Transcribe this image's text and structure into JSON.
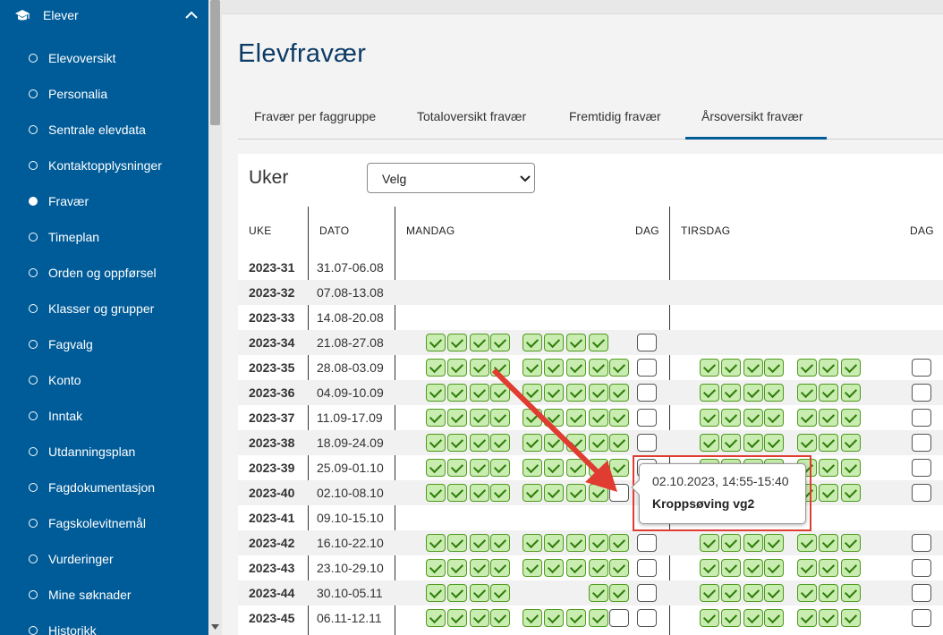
{
  "sidebar": {
    "header": "Elever",
    "items": [
      {
        "label": "Elevoversikt",
        "active": false
      },
      {
        "label": "Personalia",
        "active": false
      },
      {
        "label": "Sentrale elevdata",
        "active": false
      },
      {
        "label": "Kontaktopplysninger",
        "active": false
      },
      {
        "label": "Fravær",
        "active": true
      },
      {
        "label": "Timeplan",
        "active": false
      },
      {
        "label": "Orden og oppførsel",
        "active": false
      },
      {
        "label": "Klasser og grupper",
        "active": false
      },
      {
        "label": "Fagvalg",
        "active": false
      },
      {
        "label": "Konto",
        "active": false
      },
      {
        "label": "Inntak",
        "active": false
      },
      {
        "label": "Utdanningsplan",
        "active": false
      },
      {
        "label": "Fagdokumentasjon",
        "active": false
      },
      {
        "label": "Fagskolevitnemål",
        "active": false
      },
      {
        "label": "Vurderinger",
        "active": false
      },
      {
        "label": "Mine søknader",
        "active": false
      },
      {
        "label": "Historikk",
        "active": false
      }
    ]
  },
  "page_title": "Elevfravær",
  "tabs": [
    {
      "label": "Fravær per faggruppe",
      "active": false
    },
    {
      "label": "Totaloversikt fravær",
      "active": false
    },
    {
      "label": "Fremtidig fravær",
      "active": false
    },
    {
      "label": "Årsoversikt fravær",
      "active": true
    }
  ],
  "weeks_filter": {
    "label": "Uker",
    "selected": "Velg"
  },
  "table": {
    "headers": {
      "week": "UKE",
      "date": "DATO",
      "monday": "MANDAG",
      "monday_day": "DAG",
      "tuesday": "TIRSDAG",
      "tuesday_day": "DAG"
    },
    "rows": [
      {
        "week": "2023-31",
        "date": "31.07-06.08",
        "mon": "",
        "mon_day": "",
        "tue": "",
        "tue_day": ""
      },
      {
        "week": "2023-32",
        "date": "07.08-13.08",
        "mon": "",
        "mon_day": "",
        "tue": "",
        "tue_day": ""
      },
      {
        "week": "2023-33",
        "date": "14.08-20.08",
        "mon": "",
        "mon_day": "",
        "tue": "",
        "tue_day": ""
      },
      {
        "week": "2023-34",
        "date": "21.08-27.08",
        "mon": "xxxx-xxxx",
        "mon_day": "o",
        "tue": "",
        "tue_day": ""
      },
      {
        "week": "2023-35",
        "date": "28.08-03.09",
        "mon": "xxxx-xxxxx",
        "mon_day": "o",
        "tue": "xxxx-xxx",
        "tue_day": "o"
      },
      {
        "week": "2023-36",
        "date": "04.09-10.09",
        "mon": "xxxx-xxxxx",
        "mon_day": "o",
        "tue": "xxxx-xxx",
        "tue_day": "o"
      },
      {
        "week": "2023-37",
        "date": "11.09-17.09",
        "mon": "xxxx-xxxxx",
        "mon_day": "o",
        "tue": "xxxx-xxx",
        "tue_day": "o"
      },
      {
        "week": "2023-38",
        "date": "18.09-24.09",
        "mon": "xxxx-xxxxx",
        "mon_day": "o",
        "tue": "xxxx-xxx",
        "tue_day": "o"
      },
      {
        "week": "2023-39",
        "date": "25.09-01.10",
        "mon": "xxxx-xxxxx",
        "mon_day": "o",
        "tue": "xxxx-xxx",
        "tue_day": "o"
      },
      {
        "week": "2023-40",
        "date": "02.10-08.10",
        "mon": "xxxx-xxxxo",
        "mon_day": "",
        "tue": "xxxx-xxx",
        "tue_day": "o"
      },
      {
        "week": "2023-41",
        "date": "09.10-15.10",
        "mon": "",
        "mon_day": "",
        "tue": "",
        "tue_day": ""
      },
      {
        "week": "2023-42",
        "date": "16.10-22.10",
        "mon": "xxxx-xxxxx",
        "mon_day": "o",
        "tue": "xxxx-xxx",
        "tue_day": "o"
      },
      {
        "week": "2023-43",
        "date": "23.10-29.10",
        "mon": "xxxx-xxxxx",
        "mon_day": "o",
        "tue": "xxxx-xxx",
        "tue_day": "o"
      },
      {
        "week": "2023-44",
        "date": "30.10-05.11",
        "mon": "xxxx-___xx",
        "mon_day": "o",
        "tue": "xxxx-xxx",
        "tue_day": "o"
      },
      {
        "week": "2023-45",
        "date": "06.11-12.11",
        "mon": "xxxx-xxxxo",
        "mon_day": "o",
        "tue": "xxxx-xxx",
        "tue_day": "o"
      }
    ]
  },
  "tooltip": {
    "time": "02.10.2023, 14:55-15:40",
    "subject": "Kroppsøving vg2"
  },
  "colors": {
    "sidebar": "#005c99",
    "title": "#0d3b66",
    "check_fill": "#c9ecb0",
    "check_border": "#4d9a1d",
    "highlight": "#e03c31"
  }
}
